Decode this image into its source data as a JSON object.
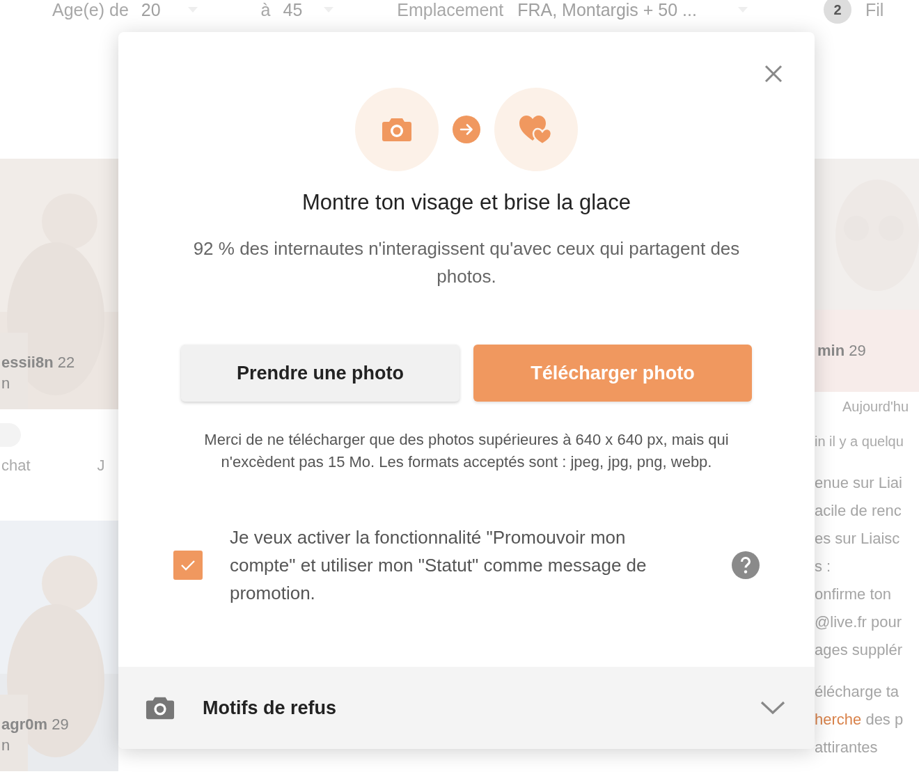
{
  "filter_bar": {
    "age_label": "Age(e) de",
    "age_min": "20",
    "to_label": "à",
    "age_max": "45",
    "location_label": "Emplacement",
    "location_value": "FRA, Montargis + 50 ...",
    "filter_count": "2",
    "filter_label": "Fil"
  },
  "left_cards": [
    {
      "name": "essii8n",
      "age": "22",
      "line_2": "n"
    },
    {
      "name": "agr0m",
      "age": "29",
      "line_2": "n"
    }
  ],
  "left_actions": [
    "chat",
    "J"
  ],
  "right_card": {
    "name": "min",
    "age": "29",
    "date": "Aujourd'hu"
  },
  "right_message": [
    [
      {
        "text": "in il y a quelqu"
      }
    ],
    [
      {
        "text": "enue sur Liai"
      },
      {
        "text": "acile de renc"
      },
      {
        "text": "es sur Liaisc"
      },
      {
        "text": "s :"
      },
      {
        "text": "onfirme ton"
      },
      {
        "text": "@live.fr pour"
      },
      {
        "text": "ages supplér"
      }
    ],
    [
      {
        "text": "élécharge ta"
      },
      {
        "link": "herche",
        "text": " des p"
      },
      {
        "text": "attirantes"
      }
    ]
  ],
  "modal": {
    "title": "Montre ton visage et brise la glace",
    "subtitle": "92 % des internautes n'interagissent qu'avec ceux qui partagent des photos.",
    "buttons": [
      {
        "label": "Prendre une photo",
        "kind": "secondary"
      },
      {
        "label": "Télécharger photo",
        "kind": "primary"
      }
    ],
    "note": "Merci de ne télécharger que des photos supérieures à 640 x 640 px, mais qui n'excèdent pas 15 Mo. Les formats acceptés sont : jpeg, jpg, png, webp.",
    "promotion": {
      "checked": true,
      "text": "Je veux activer la fonctionnalité \"Promouvoir mon compte\" et utiliser mon \"Statut\" comme message de promotion."
    },
    "footer": {
      "label": "Motifs de refus",
      "expanded": false
    }
  }
}
